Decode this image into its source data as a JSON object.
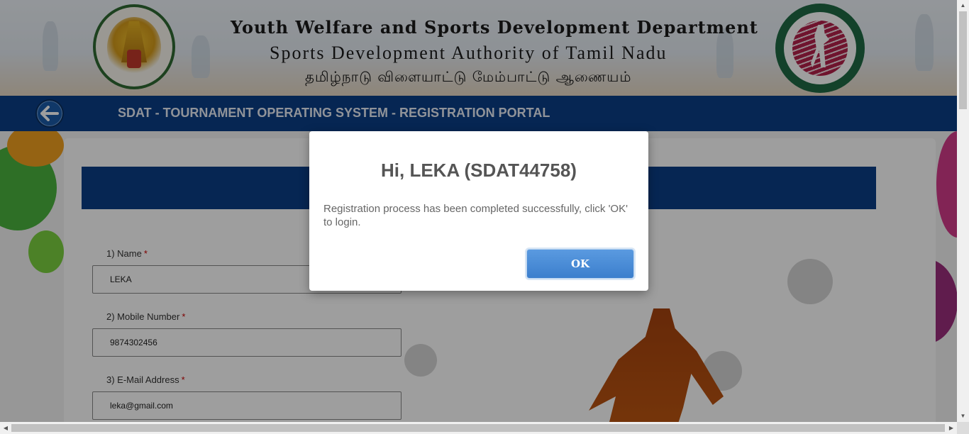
{
  "header": {
    "title_en": "Youth Welfare and Sports Development Department",
    "subtitle_en": "Sports Development Authority of Tamil Nadu",
    "title_ta": "தமிழ்நாடு விளையாட்டு மேம்பாட்டு ஆணையம்",
    "left_emblem_icon": "tamil-nadu-emblem-icon",
    "right_emblem_icon": "sdat-logo-icon"
  },
  "navbar": {
    "title": "SDAT - TOURNAMENT OPERATING SYSTEM - REGISTRATION PORTAL",
    "back_icon": "arrow-left-icon",
    "color": "#0a3e86"
  },
  "form": {
    "fields": [
      {
        "label": "1) Name",
        "value": "LEKA",
        "required": "*"
      },
      {
        "label": "2) Mobile Number",
        "value": "9874302456",
        "required": "*"
      },
      {
        "label": "3) E-Mail Address",
        "value": "leka@gmail.com",
        "required": "*"
      }
    ]
  },
  "dialog": {
    "title": "Hi, LEKA (SDAT44758)",
    "message": "Registration process has been completed successfully, click 'OK' to login.",
    "ok_label": "OK",
    "ok_color": "#3c7fcd"
  }
}
